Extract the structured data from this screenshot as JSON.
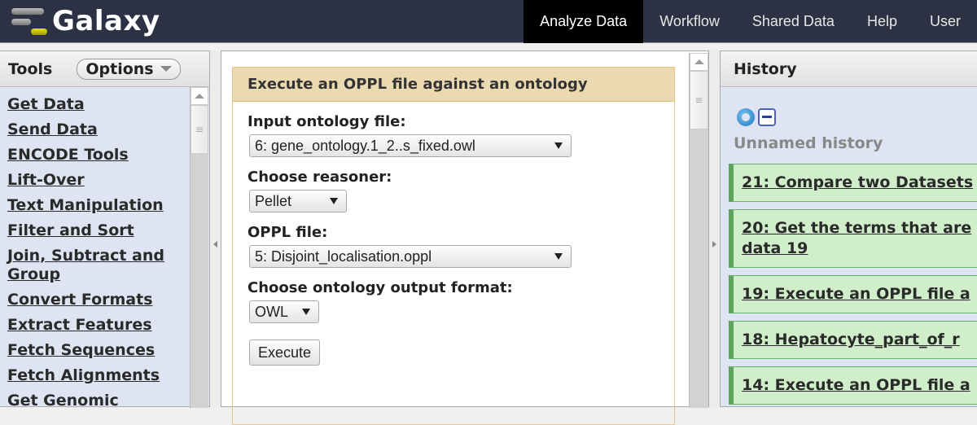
{
  "masthead": {
    "brand": "Galaxy",
    "nav": [
      "Analyze Data",
      "Workflow",
      "Shared Data",
      "Help",
      "User"
    ],
    "active_nav": "Analyze Data"
  },
  "tools_panel": {
    "title": "Tools",
    "options_label": "Options",
    "items": [
      "Get Data",
      "Send Data",
      "ENCODE Tools",
      "Lift-Over",
      "Text Manipulation",
      "Filter and Sort",
      "Join, Subtract and Group",
      "Convert Formats",
      "Extract Features",
      "Fetch Sequences",
      "Fetch Alignments",
      "Get Genomic"
    ]
  },
  "tool_form": {
    "title": "Execute an OPPL file against an ontology",
    "fields": [
      {
        "label": "Input ontology file:",
        "value": "6: gene_ontology.1_2..s_fixed.owl"
      },
      {
        "label": "Choose reasoner:",
        "value": "Pellet"
      },
      {
        "label": "OPPL file:",
        "value": "5: Disjoint_localisation.oppl"
      },
      {
        "label": "Choose ontology output format:",
        "value": "OWL"
      }
    ],
    "execute_label": "Execute"
  },
  "history_panel": {
    "title": "History",
    "history_name": "Unnamed history",
    "items": [
      {
        "text": "21: Compare two Datasets",
        "state": "ok"
      },
      {
        "text": "20: Get the terms that are",
        "text_line2": "data 19",
        "state": "ok"
      },
      {
        "text": "19: Execute an OPPL file a",
        "state": "ok"
      },
      {
        "text": "18: Hepatocyte_part_of_r",
        "state": "ok"
      },
      {
        "text": "14: Execute an OPPL file a",
        "state": "ok"
      }
    ]
  },
  "colors": {
    "masthead_bg": "#2c3143",
    "nav_active_bg": "#000000",
    "panel_bg": "#dfe4f3",
    "form_title_bg": "#ebd9b2",
    "history_ok_bg": "#cfeec9",
    "history_ok_border": "#5ea35c",
    "logo_accent": "#c8c800"
  }
}
